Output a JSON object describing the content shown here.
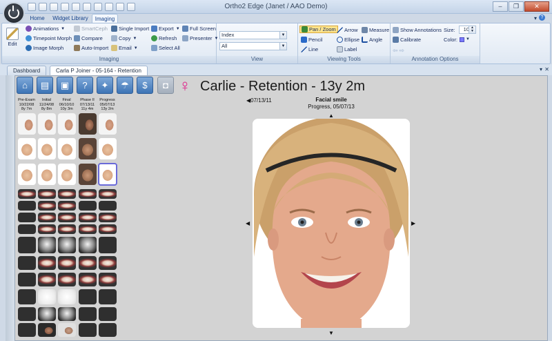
{
  "app": {
    "title": "Ortho2 Edge (Janet / AAO Demo)",
    "window_controls": [
      "–",
      "❐",
      "✕"
    ]
  },
  "ribbon": {
    "tabs": [
      "Home",
      "Widget Library",
      "Imaging"
    ],
    "active_tab": "Imaging",
    "groups": {
      "imaging": {
        "label": "Imaging",
        "edit": "Edit",
        "animations": "Animations",
        "timepoint_morph": "Timepoint Morph",
        "image_morph": "Image Morph",
        "smartceph": "SmartCeph",
        "compare": "Compare",
        "auto_import": "Auto-Import",
        "single_import": "Single Import",
        "copy": "Copy",
        "email": "Email",
        "export": "Export",
        "refresh": "Refresh",
        "select_all": "Select All",
        "full_screen": "Full Screen",
        "presenter": "Presenter"
      },
      "view": {
        "label": "View",
        "combo1": "Index",
        "combo2": "All"
      },
      "viewing_tools": {
        "label": "Viewing Tools",
        "pan_zoom": "Pan / Zoom",
        "pencil": "Pencil",
        "line": "Line",
        "arrow": "Arrow",
        "ellipse": "Ellipse",
        "label_tool": "Label",
        "measure": "Measure",
        "angle": "Angle"
      },
      "annotation_options": {
        "label": "Annotation Options",
        "show_annotations": "Show Annotations",
        "calibrate": "Calibrate",
        "size_label": "Size:",
        "size_value": "10",
        "color_label": "Color:",
        "color_value": "#7b7bff"
      }
    }
  },
  "doc_tabs": [
    "Dashboard",
    "Carla P Joiner - 05-164 - Retention"
  ],
  "patient": {
    "title": "Carlie - Retention - 13y 2m",
    "sex_symbol": "♀",
    "sex_color": "#e0218a"
  },
  "nav_icons": [
    "home-icon",
    "chart-icon",
    "form-icon",
    "help-icon",
    "compass-icon",
    "umbrella-icon",
    "money-icon",
    "camera-icon"
  ],
  "timepoints": [
    {
      "name": "Pre-Exam",
      "date": "10/22/08",
      "age": "8y 7m"
    },
    {
      "name": "Initial",
      "date": "11/24/08",
      "age": "8y 8m"
    },
    {
      "name": "Final",
      "date": "06/10/10",
      "age": "10y 3m"
    },
    {
      "name": "Phase II",
      "date": "07/13/11",
      "age": "11y 4m"
    },
    {
      "name": "Progress",
      "date": "05/07/13",
      "age": "13y 2m"
    }
  ],
  "viewer": {
    "prev_date": "07/13/11",
    "image_title": "Facial smile",
    "image_subtitle": "Progress, 05/07/13",
    "arrows": {
      "up": "▲",
      "down": "▼",
      "left": "◀",
      "right": "▶",
      "prev": "◀"
    }
  }
}
